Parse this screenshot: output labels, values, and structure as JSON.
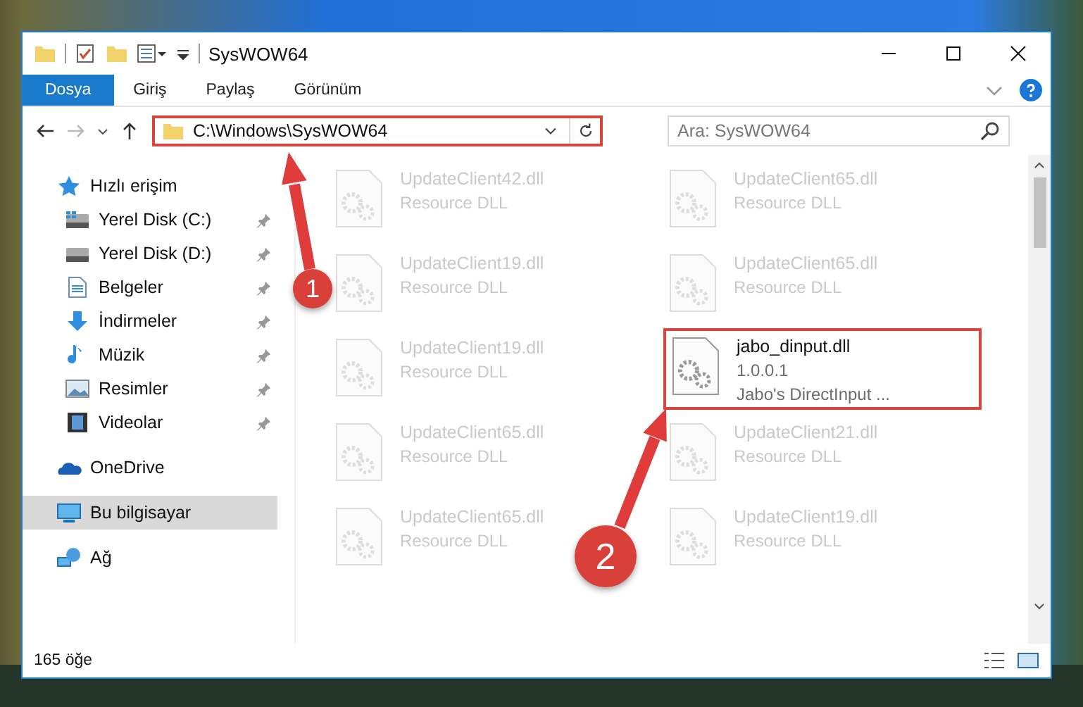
{
  "window": {
    "title": "SysWOW64"
  },
  "ribbon_tabs": [
    {
      "label": "Dosya",
      "selected": true
    },
    {
      "label": "Giriş",
      "selected": false
    },
    {
      "label": "Paylaş",
      "selected": false
    },
    {
      "label": "Görünüm",
      "selected": false
    }
  ],
  "address": {
    "path": "C:\\Windows\\SysWOW64",
    "highlighted": true
  },
  "search": {
    "placeholder": "Ara: SysWOW64"
  },
  "sidebar": {
    "items": [
      {
        "label": "Hızlı erişim",
        "kind": "star",
        "selected": false,
        "children": [
          {
            "label": "Yerel Disk (C:)",
            "kind": "drive-windows",
            "pinned": true
          },
          {
            "label": "Yerel Disk (D:)",
            "kind": "drive",
            "pinned": true
          },
          {
            "label": "Belgeler",
            "kind": "document",
            "pinned": true
          },
          {
            "label": "İndirmeler",
            "kind": "download",
            "pinned": true
          },
          {
            "label": "Müzik",
            "kind": "music",
            "pinned": true
          },
          {
            "label": "Resimler",
            "kind": "picture",
            "pinned": true
          },
          {
            "label": "Videolar",
            "kind": "video",
            "pinned": true
          }
        ]
      },
      {
        "label": "OneDrive",
        "kind": "cloud",
        "selected": false
      },
      {
        "label": "Bu bilgisayar",
        "kind": "computer",
        "selected": true
      },
      {
        "label": "Ağ",
        "kind": "network",
        "selected": false
      }
    ]
  },
  "files": [
    {
      "name": "UpdateClient42.dll",
      "lines": [
        "Resource DLL"
      ],
      "faded": true,
      "highlighted": false
    },
    {
      "name": "UpdateClient65.dll",
      "lines": [
        "Resource DLL"
      ],
      "faded": true,
      "highlighted": false
    },
    {
      "name": "UpdateClient19.dll",
      "lines": [
        "Resource DLL"
      ],
      "faded": true,
      "highlighted": false
    },
    {
      "name": "UpdateClient65.dll",
      "lines": [
        "Resource DLL"
      ],
      "faded": true,
      "highlighted": false
    },
    {
      "name": "UpdateClient19.dll",
      "lines": [
        "Resource DLL"
      ],
      "faded": true,
      "highlighted": false
    },
    {
      "name": "jabo_dinput.dll",
      "lines": [
        "1.0.0.1",
        "Jabo's DirectInput ..."
      ],
      "faded": false,
      "highlighted": true
    },
    {
      "name": "UpdateClient65.dll",
      "lines": [
        "Resource DLL"
      ],
      "faded": true,
      "highlighted": false
    },
    {
      "name": "UpdateClient21.dll",
      "lines": [
        "Resource DLL"
      ],
      "faded": true,
      "highlighted": false
    },
    {
      "name": "UpdateClient65.dll",
      "lines": [
        "Resource DLL"
      ],
      "faded": true,
      "highlighted": false
    },
    {
      "name": "UpdateClient19.dll",
      "lines": [
        "Resource DLL"
      ],
      "faded": true,
      "highlighted": false
    }
  ],
  "status_bar": {
    "count": "165 öğe"
  },
  "annotations": [
    {
      "number": "1"
    },
    {
      "number": "2"
    }
  ]
}
